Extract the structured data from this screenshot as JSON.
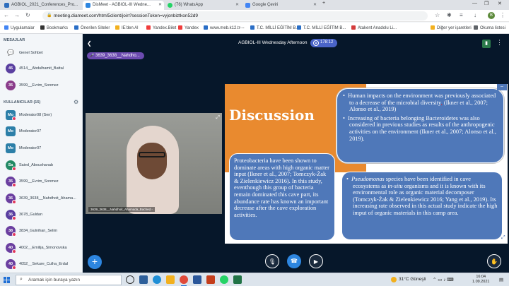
{
  "browser": {
    "tabs": [
      {
        "label": "AGBIOL_2021_Conferences_Pro...",
        "color": "#2f6ebd",
        "active": false
      },
      {
        "label": "DisMeet - AGBIOL-III Wedne...",
        "color": "#2d86e0",
        "active": true
      },
      {
        "label": "(76) WhatsApp",
        "color": "#25d366",
        "active": false
      },
      {
        "label": "Google Çeviri",
        "color": "#4285f4",
        "active": false
      }
    ],
    "url": "meeting.diameet.com/html5client/join?sessionToken=vyjonbiztkon52d9",
    "bookmarks": [
      {
        "label": "Uygulamalar",
        "color": "#4285f4"
      },
      {
        "label": "Bookmarks",
        "color": "#333333"
      },
      {
        "label": "Önerilen Siteler",
        "color": "#2a6ec6"
      },
      {
        "label": "IE'den Al",
        "color": "#f2b01e"
      },
      {
        "label": "Yandex.Bilet",
        "color": "#f03c3c"
      },
      {
        "label": "Yandex",
        "color": "#f03c3c"
      },
      {
        "label": "www.meb.k12.tr---",
        "color": "#2a6ec6"
      },
      {
        "label": "T.C. MİLLİ EĞİTİM B...",
        "color": "#2a6ec6"
      },
      {
        "label": "T.C. MİLLİ EĞİTİM B...",
        "color": "#2a6ec6"
      },
      {
        "label": "Atakent Anadolu Li...",
        "color": "#d33b3b"
      },
      {
        "label": "Diğer yer işaretleri",
        "color": "#f2b01e"
      },
      {
        "label": "Okuma listesi",
        "color": "#5f6368"
      }
    ],
    "profile_initial": "B"
  },
  "sidebar": {
    "messages_header": "MESAJLAR",
    "public_chat": "Genel Sohbet",
    "chats": [
      {
        "initials": "45",
        "name": "4514__Abdulhamit_Battal",
        "color": "#5a3fa0"
      },
      {
        "initials": "35",
        "name": "3599__Evrim_Sonmez",
        "color": "#8b3d8b"
      }
    ],
    "users_header": "KULLANICILAR (15)",
    "users": [
      {
        "initials": "Mo",
        "name": "Moderator08 (Sen)",
        "color": "#2c7fa8",
        "square": true,
        "badge": true
      },
      {
        "initials": "Mo",
        "name": "Moderator07",
        "color": "#2c7fa8",
        "square": true,
        "badge": false
      },
      {
        "initials": "Mo",
        "name": "Moderator07",
        "color": "#2c7fa8",
        "square": true,
        "badge": false
      },
      {
        "initials": "Sa",
        "name": "Saied_Aboushanab",
        "color": "#238a65",
        "square": false,
        "badge": true
      },
      {
        "initials": "35",
        "name": "3599__Evrim_Sonmez",
        "color": "#6b3fa0",
        "square": false,
        "badge": true
      },
      {
        "initials": "36",
        "name": "3639_3638__Nahdhoit_Ahama...",
        "color": "#6b3fa0",
        "square": false,
        "badge": true
      },
      {
        "initials": "36",
        "name": "3678_Guldan",
        "color": "#5a3fa0",
        "square": false,
        "badge": true
      },
      {
        "initials": "38",
        "name": "3834_Gulnihan_Selim",
        "color": "#6b3fa0",
        "square": false,
        "badge": true
      },
      {
        "initials": "40",
        "name": "4002__Emilija_Simonovska",
        "color": "#6b3fa0",
        "square": false,
        "badge": true
      },
      {
        "initials": "40",
        "name": "4052__Sekure_Culha_Erdal",
        "color": "#6b3fa0",
        "square": false,
        "badge": true
      }
    ]
  },
  "meeting": {
    "title": "AGBIOL-III Wednesday Afternoon",
    "recording_time": "178:12",
    "presenter": "3639_3638__Nahdho...",
    "webcam_label": "3639_3638__Nahdhoit_Ahamada_Bached -"
  },
  "slide": {
    "heading": "Discussion",
    "bubble1": {
      "bullet1_pre": "Human impacts on the environment was previously associated to a decrease of the microbial diversity",
      "bullet1_post": " (Ikner et al., 2007; Alonso et al., 2019)",
      "bullet2": "Increasing of bacteria belonging Bacteroidetes was also considered in previous studies as results of the anthropogenic activities on the environment (Ikner et al., 2007; Alonso et al., 2019)."
    },
    "bubble2": "Proteobacteria have been shown to dominate areas with high organic matter input (Ikner et al., 2007; Tomczyk-Żak & Zielenkiewicz 2016). In this study, eventhough this group of bacteria remain dominated this cave part, its abundance rate has known an important decrease after the cave exploration activities.",
    "bubble3": {
      "italic_word": "Pseudomonas",
      "part1": " species have been identified in cave ecosystems as ",
      "italic_word2": "in-situ",
      "part2": " organisms and it is known with its environmental role as organic material decomposer (Tomczyk-Żak & Zielenkiewicz 2016; Yang et al., 2019). Its increasing rate observed in this actual study indicate the high imput of organic materials in this camp area."
    },
    "bullet_char": "•"
  },
  "taskbar": {
    "search_placeholder": "Aramak için buraya yazın",
    "weather": "31°C  Güneşli",
    "time": "16:04",
    "date": "1.09.2021"
  }
}
